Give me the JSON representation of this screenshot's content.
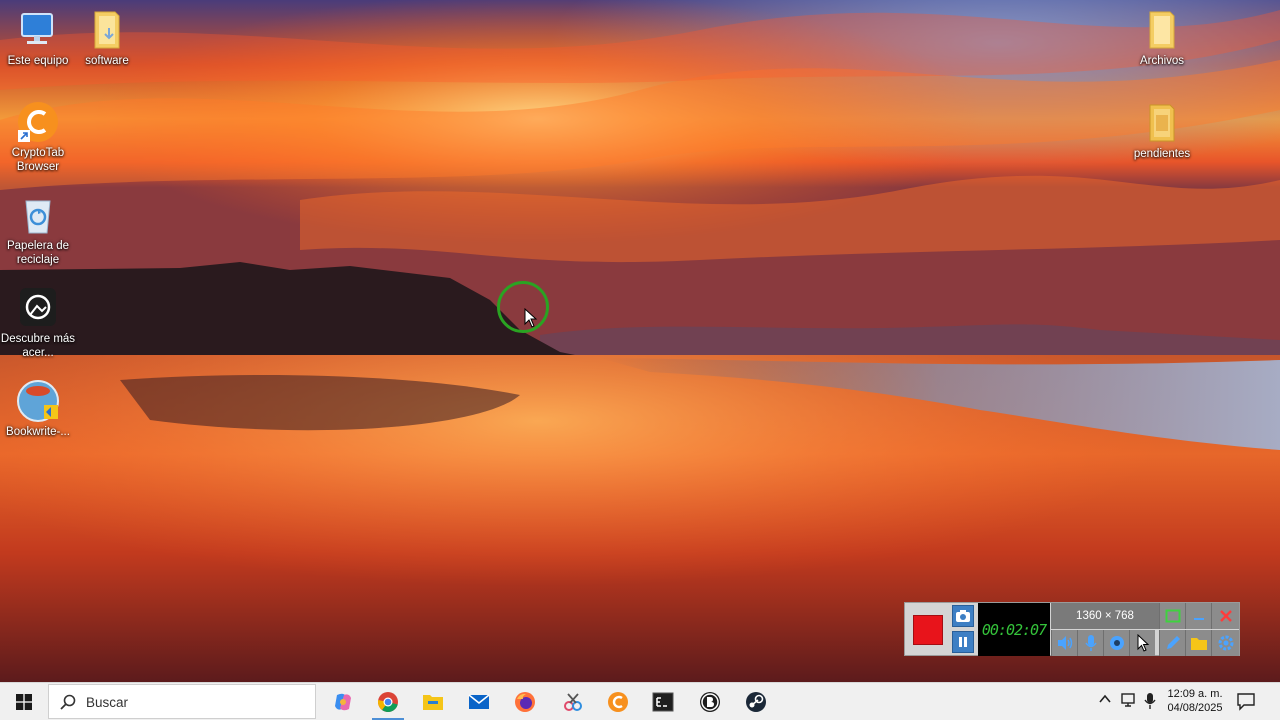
{
  "desktop": {
    "icons": [
      {
        "name": "this-pc",
        "label": "Este equipo"
      },
      {
        "name": "software-folder",
        "label": "software"
      },
      {
        "name": "cryptotab-browser",
        "label": "CryptoTab Browser"
      },
      {
        "name": "recycle-bin",
        "label": "Papelera de reciclaje"
      },
      {
        "name": "discover-acer",
        "label": "Descubre más acer..."
      },
      {
        "name": "bookwrite",
        "label": "Bookwrite-..."
      },
      {
        "name": "archivos-folder",
        "label": "Archivos"
      },
      {
        "name": "pendientes-folder",
        "label": "pendientes"
      }
    ]
  },
  "recorder": {
    "timer": "00:02:07",
    "resolution": "1360 × 768",
    "colors": {
      "record": "#e8141b",
      "timer_text": "#34c23a"
    }
  },
  "taskbar": {
    "search_placeholder": "Buscar",
    "apps": [
      "copilot-icon",
      "chrome-icon",
      "file-explorer-icon",
      "mail-icon",
      "firefox-icon",
      "snipping-tool-icon",
      "cryptotab-icon",
      "terminal-icon",
      "bitwarden-icon",
      "steam-icon"
    ],
    "clock": {
      "time": "12:09 a. m.",
      "date": "04/08/2025"
    }
  }
}
